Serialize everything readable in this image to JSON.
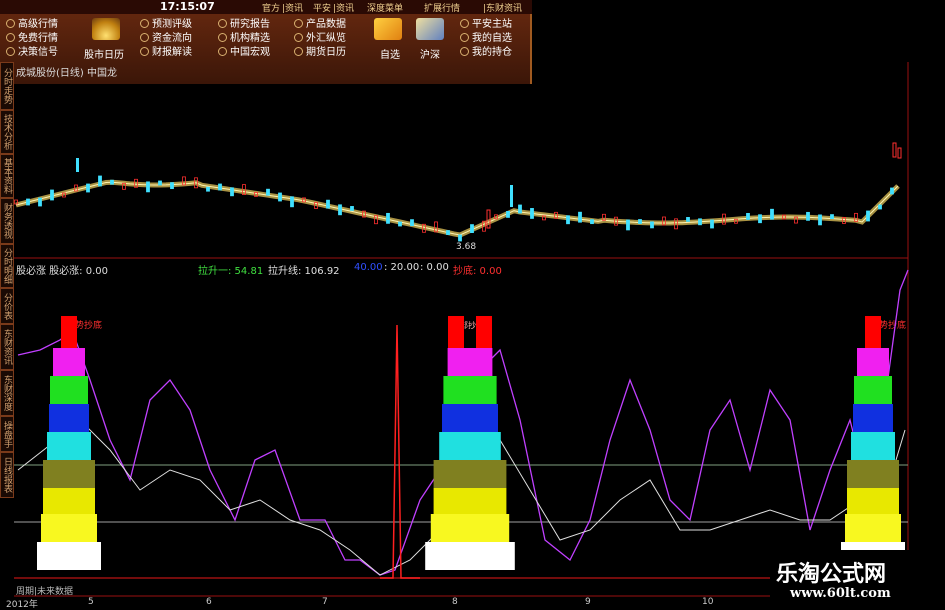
{
  "menu": {
    "clock": "17:15:07",
    "tabs": [
      "官方",
      "|资讯",
      "平安",
      "|资讯",
      "深度菜单",
      "扩展行情",
      "|东财资讯"
    ],
    "col1": [
      "高级行情",
      "免费行情",
      "决策信号"
    ],
    "big1": "股市日历",
    "col2": [
      "预测评级",
      "资金流向",
      "财报解读"
    ],
    "col3": [
      "研究报告",
      "机构精选",
      "中国宏观"
    ],
    "col4": [
      "产品数据",
      "外汇纵览",
      "期货日历"
    ],
    "big2": "自选",
    "big3": "沪深",
    "col5": [
      "平安主站",
      "我的自选",
      "我的持仓"
    ]
  },
  "side_tabs": [
    "分时走势",
    "技术分析",
    "基本资料",
    "财务透视",
    "分时明细",
    "分价表",
    "东财资讯",
    "东财深度",
    "操盘手",
    "日线报表"
  ],
  "chart_title": "成城股份(日线)  中国龙",
  "price_low": "3.68",
  "indicator_left": "股必涨  股必涨: 0.00",
  "indicator_values": {
    "label1": "拉升一: 54.81",
    "label2": "拉升线: 106.92",
    "v3": "40.00",
    "v4": ": 20.00",
    "v5": ": 0.00",
    "label6": "抄底: 0.00"
  },
  "tower_labels": [
    "强势抄底",
    "底部抄底",
    "强势抄底"
  ],
  "bottom_left": "周期|未来数据",
  "x_axis": [
    "2012年",
    "5",
    "6",
    "7",
    "8",
    "9",
    "10"
  ],
  "watermark": {
    "title": "乐淘公式网",
    "url": "www.60lt.com"
  },
  "colors": {
    "up": "#ff3030",
    "down": "#40e0ff",
    "ma": "#f0d060",
    "purple": "#c040ff",
    "white_line": "#e0e0e0",
    "spike": "#ff2020",
    "panel_border": "#9a1010"
  }
}
